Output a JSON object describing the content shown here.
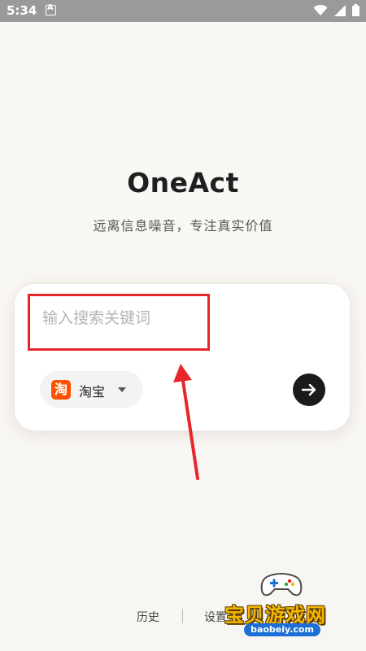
{
  "status_bar": {
    "time": "5:34",
    "notification_icon": "a-notification-icon",
    "wifi_icon": "wifi-icon",
    "signal_icon": "signal-icon",
    "battery_icon": "battery-icon"
  },
  "app": {
    "title": "OneAct",
    "subtitle": "远离信息噪音，专注真实价值"
  },
  "search": {
    "placeholder": "输入搜索关键词",
    "value": "",
    "platform": {
      "label": "淘宝",
      "logo_text": "淘",
      "logo_color": "#ff5000"
    },
    "go_icon": "arrow-right-icon"
  },
  "bottom_nav": {
    "history": "历史",
    "settings": "设置"
  },
  "watermark": {
    "text": "宝贝游戏网",
    "url": "baobeiy.com"
  },
  "colors": {
    "accent": "#1b1b1b",
    "annotation": "#e8262a",
    "background": "#faf8f5"
  }
}
